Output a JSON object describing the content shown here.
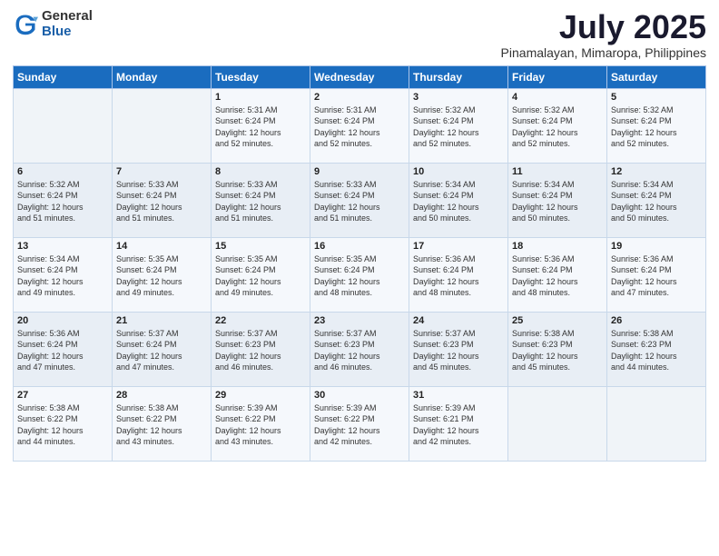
{
  "header": {
    "logo_general": "General",
    "logo_blue": "Blue",
    "month_title": "July 2025",
    "subtitle": "Pinamalayan, Mimaropa, Philippines"
  },
  "weekdays": [
    "Sunday",
    "Monday",
    "Tuesday",
    "Wednesday",
    "Thursday",
    "Friday",
    "Saturday"
  ],
  "weeks": [
    [
      {
        "day": "",
        "info": ""
      },
      {
        "day": "",
        "info": ""
      },
      {
        "day": "1",
        "info": "Sunrise: 5:31 AM\nSunset: 6:24 PM\nDaylight: 12 hours\nand 52 minutes."
      },
      {
        "day": "2",
        "info": "Sunrise: 5:31 AM\nSunset: 6:24 PM\nDaylight: 12 hours\nand 52 minutes."
      },
      {
        "day": "3",
        "info": "Sunrise: 5:32 AM\nSunset: 6:24 PM\nDaylight: 12 hours\nand 52 minutes."
      },
      {
        "day": "4",
        "info": "Sunrise: 5:32 AM\nSunset: 6:24 PM\nDaylight: 12 hours\nand 52 minutes."
      },
      {
        "day": "5",
        "info": "Sunrise: 5:32 AM\nSunset: 6:24 PM\nDaylight: 12 hours\nand 52 minutes."
      }
    ],
    [
      {
        "day": "6",
        "info": "Sunrise: 5:32 AM\nSunset: 6:24 PM\nDaylight: 12 hours\nand 51 minutes."
      },
      {
        "day": "7",
        "info": "Sunrise: 5:33 AM\nSunset: 6:24 PM\nDaylight: 12 hours\nand 51 minutes."
      },
      {
        "day": "8",
        "info": "Sunrise: 5:33 AM\nSunset: 6:24 PM\nDaylight: 12 hours\nand 51 minutes."
      },
      {
        "day": "9",
        "info": "Sunrise: 5:33 AM\nSunset: 6:24 PM\nDaylight: 12 hours\nand 51 minutes."
      },
      {
        "day": "10",
        "info": "Sunrise: 5:34 AM\nSunset: 6:24 PM\nDaylight: 12 hours\nand 50 minutes."
      },
      {
        "day": "11",
        "info": "Sunrise: 5:34 AM\nSunset: 6:24 PM\nDaylight: 12 hours\nand 50 minutes."
      },
      {
        "day": "12",
        "info": "Sunrise: 5:34 AM\nSunset: 6:24 PM\nDaylight: 12 hours\nand 50 minutes."
      }
    ],
    [
      {
        "day": "13",
        "info": "Sunrise: 5:34 AM\nSunset: 6:24 PM\nDaylight: 12 hours\nand 49 minutes."
      },
      {
        "day": "14",
        "info": "Sunrise: 5:35 AM\nSunset: 6:24 PM\nDaylight: 12 hours\nand 49 minutes."
      },
      {
        "day": "15",
        "info": "Sunrise: 5:35 AM\nSunset: 6:24 PM\nDaylight: 12 hours\nand 49 minutes."
      },
      {
        "day": "16",
        "info": "Sunrise: 5:35 AM\nSunset: 6:24 PM\nDaylight: 12 hours\nand 48 minutes."
      },
      {
        "day": "17",
        "info": "Sunrise: 5:36 AM\nSunset: 6:24 PM\nDaylight: 12 hours\nand 48 minutes."
      },
      {
        "day": "18",
        "info": "Sunrise: 5:36 AM\nSunset: 6:24 PM\nDaylight: 12 hours\nand 48 minutes."
      },
      {
        "day": "19",
        "info": "Sunrise: 5:36 AM\nSunset: 6:24 PM\nDaylight: 12 hours\nand 47 minutes."
      }
    ],
    [
      {
        "day": "20",
        "info": "Sunrise: 5:36 AM\nSunset: 6:24 PM\nDaylight: 12 hours\nand 47 minutes."
      },
      {
        "day": "21",
        "info": "Sunrise: 5:37 AM\nSunset: 6:24 PM\nDaylight: 12 hours\nand 47 minutes."
      },
      {
        "day": "22",
        "info": "Sunrise: 5:37 AM\nSunset: 6:23 PM\nDaylight: 12 hours\nand 46 minutes."
      },
      {
        "day": "23",
        "info": "Sunrise: 5:37 AM\nSunset: 6:23 PM\nDaylight: 12 hours\nand 46 minutes."
      },
      {
        "day": "24",
        "info": "Sunrise: 5:37 AM\nSunset: 6:23 PM\nDaylight: 12 hours\nand 45 minutes."
      },
      {
        "day": "25",
        "info": "Sunrise: 5:38 AM\nSunset: 6:23 PM\nDaylight: 12 hours\nand 45 minutes."
      },
      {
        "day": "26",
        "info": "Sunrise: 5:38 AM\nSunset: 6:23 PM\nDaylight: 12 hours\nand 44 minutes."
      }
    ],
    [
      {
        "day": "27",
        "info": "Sunrise: 5:38 AM\nSunset: 6:22 PM\nDaylight: 12 hours\nand 44 minutes."
      },
      {
        "day": "28",
        "info": "Sunrise: 5:38 AM\nSunset: 6:22 PM\nDaylight: 12 hours\nand 43 minutes."
      },
      {
        "day": "29",
        "info": "Sunrise: 5:39 AM\nSunset: 6:22 PM\nDaylight: 12 hours\nand 43 minutes."
      },
      {
        "day": "30",
        "info": "Sunrise: 5:39 AM\nSunset: 6:22 PM\nDaylight: 12 hours\nand 42 minutes."
      },
      {
        "day": "31",
        "info": "Sunrise: 5:39 AM\nSunset: 6:21 PM\nDaylight: 12 hours\nand 42 minutes."
      },
      {
        "day": "",
        "info": ""
      },
      {
        "day": "",
        "info": ""
      }
    ]
  ]
}
